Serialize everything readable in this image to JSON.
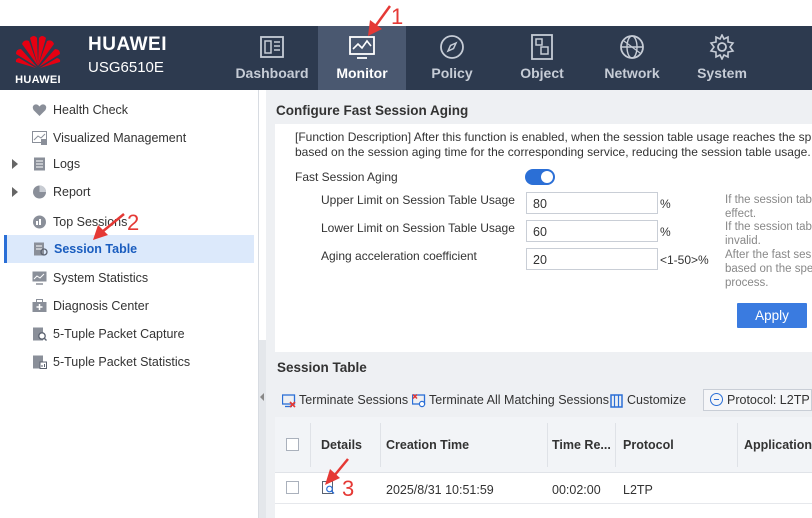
{
  "header": {
    "logo_text": "HUAWEI",
    "brand": "HUAWEI",
    "model": "USG6510E",
    "tabs": [
      {
        "label": "Dashboard",
        "icon": "dashboard-icon"
      },
      {
        "label": "Monitor",
        "icon": "monitor-icon",
        "active": true
      },
      {
        "label": "Policy",
        "icon": "policy-compass-icon"
      },
      {
        "label": "Object",
        "icon": "object-icon"
      },
      {
        "label": "Network",
        "icon": "network-globe-icon"
      },
      {
        "label": "System",
        "icon": "system-gear-icon"
      }
    ]
  },
  "sidebar": {
    "items": [
      {
        "label": "Health Check",
        "icon": "heart-icon"
      },
      {
        "label": "Visualized Management",
        "icon": "chart-icon"
      },
      {
        "label": "Logs",
        "icon": "document-icon",
        "expandable": true
      },
      {
        "label": "Report",
        "icon": "pie-chart-icon",
        "expandable": true
      },
      {
        "label": "Top Sessions",
        "icon": "top-sessions-icon"
      },
      {
        "label": "Session Table",
        "icon": "session-table-icon",
        "active": true
      },
      {
        "label": "System Statistics",
        "icon": "statistics-icon"
      },
      {
        "label": "Diagnosis Center",
        "icon": "diagnosis-icon"
      },
      {
        "label": "5-Tuple Packet Capture",
        "icon": "capture-icon"
      },
      {
        "label": "5-Tuple Packet Statistics",
        "icon": "packet-statistics-icon"
      }
    ]
  },
  "fast_aging": {
    "title": "Configure Fast Session Aging",
    "desc_line1": "[Function Description] After this function is enabled, when the session table usage reaches the sp",
    "desc_line2": "based on the session aging time for the corresponding service, reducing the session table usage.",
    "toggle_label": "Fast Session Aging",
    "toggle_on": true,
    "upper_label": "Upper Limit on Session Table Usage",
    "upper_value": "80",
    "upper_unit": "%",
    "lower_label": "Lower Limit on Session Table Usage",
    "lower_value": "60",
    "lower_unit": "%",
    "coef_label": "Aging acceleration coefficient",
    "coef_value": "20",
    "coef_unit": "<1-50>%",
    "hint1_line1": "If the session tab",
    "hint1_line2": "effect.",
    "hint2_line1": "If the session tab",
    "hint2_line2": "invalid.",
    "hint3_line1": "After the fast ses",
    "hint3_line2": "based on the spe",
    "hint3_line3": "process.",
    "apply_label": "Apply"
  },
  "session_table": {
    "title": "Session Table",
    "toolbar": {
      "terminate": "Terminate Sessions",
      "terminate_all": "Terminate All Matching Sessions",
      "customize": "Customize",
      "protocol_filter": "Protocol: L2TP"
    },
    "columns": [
      "Details",
      "Creation Time",
      "Time Re...",
      "Protocol",
      "Application"
    ],
    "rows": [
      {
        "creation_time": "2025/8/31 10:51:59",
        "time_remaining": "00:02:00",
        "protocol": "L2TP",
        "application": ""
      }
    ]
  },
  "annotations": {
    "step1": "1",
    "step2": "2",
    "step3": "3"
  },
  "colors": {
    "header_bg": "#2d3a4f",
    "active_tab_bg": "#4a5870",
    "accent": "#2b6fd6",
    "annotation_red": "#e53935"
  }
}
